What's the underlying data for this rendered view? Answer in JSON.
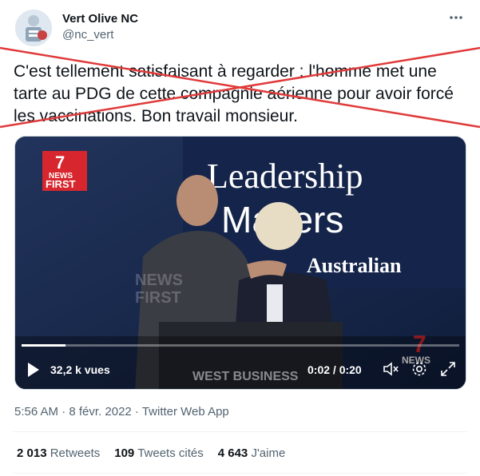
{
  "user": {
    "display_name": "Vert Olive NC",
    "handle": "@nc_vert",
    "avatar_icon": "avatar-image",
    "more_icon": "more-options-icon"
  },
  "tweet": {
    "text": "C'est tellement satisfaisant à regarder : l'homme met une tarte au PDG de cette compagnie aérienne pour avoir forcé les vaccinations. Bon travail monsieur."
  },
  "video": {
    "overlay": {
      "banner_line1": "Leadership",
      "banner_line2": "Matters",
      "banner_line3": "Australian",
      "badge_top": "NEWS",
      "badge_bottom": "FIRST",
      "watermark_top": "NEWS",
      "watermark_bottom": "FIRST",
      "corner_badge": "NEWS",
      "lectern_text": "WEST BUSINESS"
    },
    "views": "32,2 k vues",
    "time": "0:02 / 0:20",
    "progress": 0.1,
    "icons": [
      "play-icon",
      "volume-icon",
      "settings-icon",
      "fullscreen-icon"
    ]
  },
  "meta": {
    "timestamp": "5:56 AM · 8 févr. 2022 · Twitter Web App"
  },
  "stats": {
    "retweets_count": "2 013",
    "retweets_label": "Retweets",
    "quotes_count": "109",
    "quotes_label": "Tweets cités",
    "likes_count": "4 643",
    "likes_label": "J'aime"
  },
  "colors": {
    "strike": "#e03a3a",
    "text": "#0f1419",
    "muted": "#536471",
    "banner_bg": "#1a2a4c",
    "news_red": "#d7262d"
  }
}
